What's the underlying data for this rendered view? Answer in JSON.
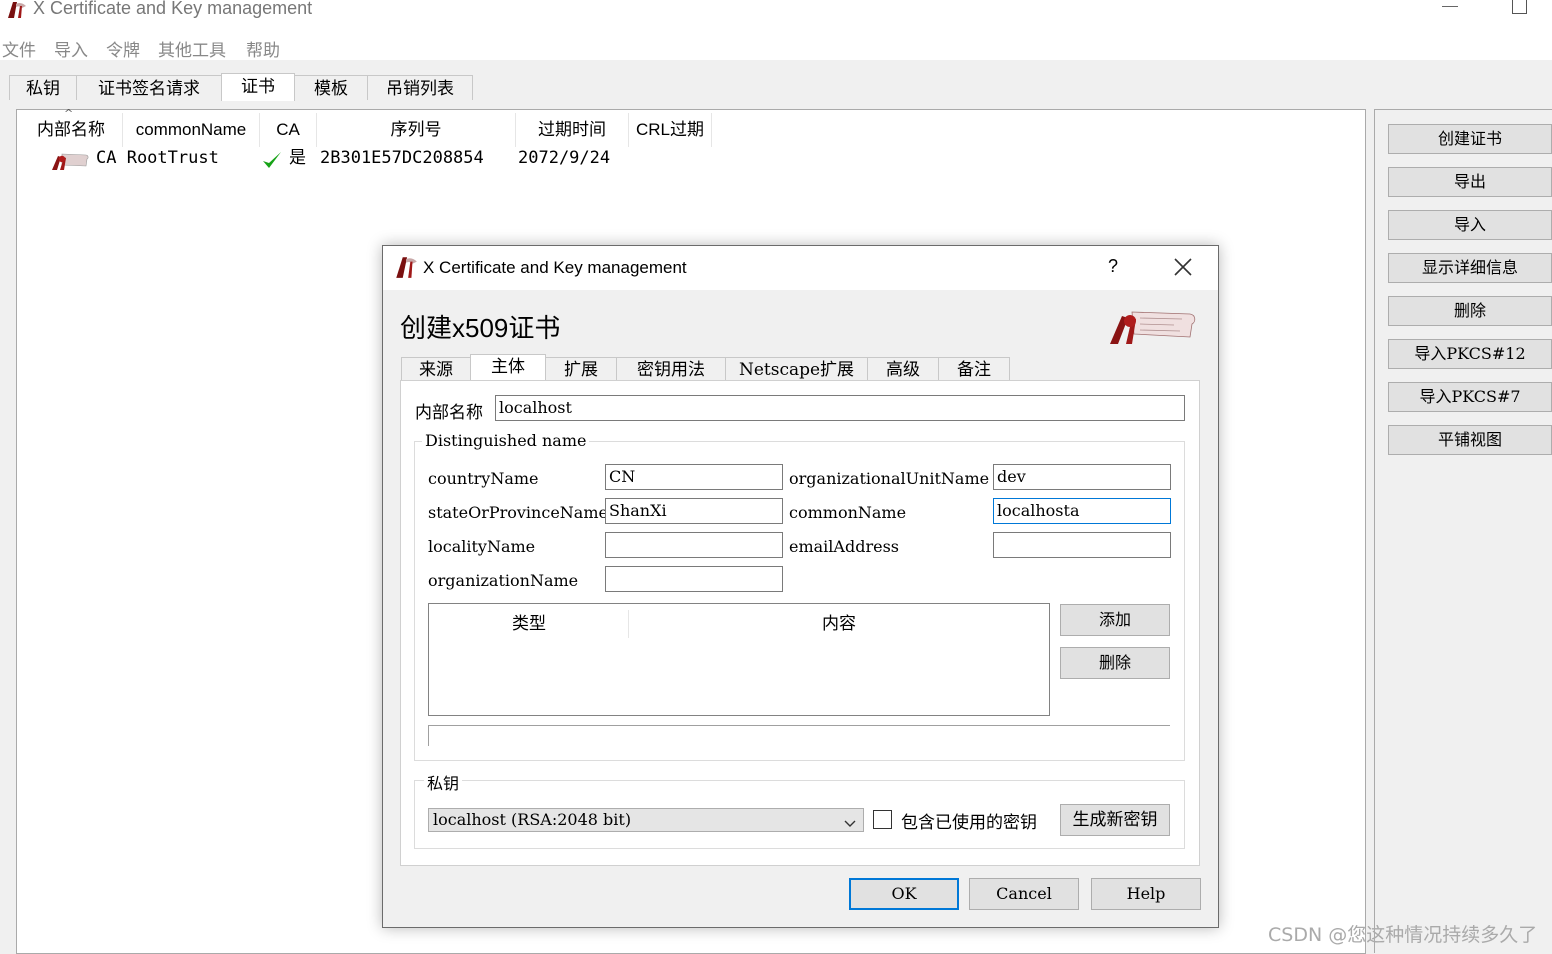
{
  "app": {
    "title": "X Certificate and Key management",
    "accent_color": "#0078d7",
    "menu": [
      "文件",
      "导入",
      "令牌",
      "其他工具",
      "帮助"
    ],
    "tabs": [
      "私钥",
      "证书签名请求",
      "证书",
      "模板",
      "吊销列表"
    ],
    "active_tab": "证书"
  },
  "cert_list": {
    "columns": [
      "内部名称",
      "commonName",
      "CA",
      "序列号",
      "过期时间",
      "CRL过期"
    ],
    "rows": [
      {
        "name": "CA RootTrust",
        "ca": "是",
        "serial": "2B301E57DC208854",
        "expiry": "2072/9/24"
      }
    ]
  },
  "side_buttons": [
    "创建证书",
    "导出",
    "导入",
    "显示详细信息",
    "删除",
    "导入PKCS#12",
    "导入PKCS#7",
    "平铺视图"
  ],
  "dialog": {
    "title": "X Certificate and Key management",
    "help_symbol": "?",
    "heading": "创建x509证书",
    "tabs": [
      "来源",
      "主体",
      "扩展",
      "密钥用法",
      "Netscape扩展",
      "高级",
      "备注"
    ],
    "active_tab": "主体",
    "internal_name_label": "内部名称",
    "internal_name_value": "localhost",
    "dn_group_title": "Distinguished name",
    "fields": {
      "countryName": {
        "label": "countryName",
        "value": "CN"
      },
      "stateOrProvinceName": {
        "label": "stateOrProvinceName",
        "value": "ShanXi"
      },
      "localityName": {
        "label": "localityName",
        "value": ""
      },
      "organizationName": {
        "label": "organizationName",
        "value": ""
      },
      "organizationalUnitName": {
        "label": "organizationalUnitName",
        "value": "dev"
      },
      "commonName": {
        "label": "commonName",
        "value": "localhosta"
      },
      "emailAddress": {
        "label": "emailAddress",
        "value": ""
      }
    },
    "ext_table_columns": [
      "类型",
      "内容"
    ],
    "add_button": "添加",
    "delete_button": "删除",
    "private_key_group_title": "私钥",
    "private_key_selected": "localhost (RSA:2048 bit)",
    "include_used_keys_label": "包含已使用的密钥",
    "include_used_keys_checked": false,
    "generate_key_button": "生成新密钥",
    "ok": "OK",
    "cancel": "Cancel",
    "help": "Help"
  },
  "watermark": "CSDN @您这种情况持续多久了"
}
